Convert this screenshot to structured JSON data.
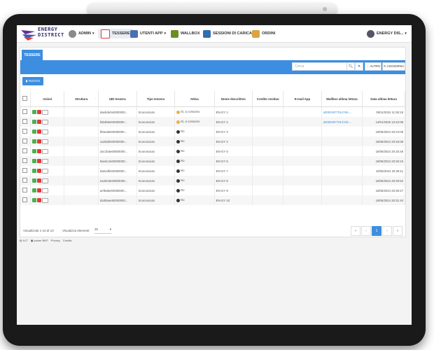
{
  "header": {
    "logo_line1": "ENERGY",
    "logo_line2": "DISTRICT",
    "nav": [
      {
        "label": "ADMIN",
        "icon": "gear-icon"
      },
      {
        "label": "TESSERE",
        "icon": "card-icon"
      },
      {
        "label": "UTENTI APP",
        "icon": "user-icon"
      },
      {
        "label": "WALLBOX",
        "icon": "charger-icon"
      },
      {
        "label": "SESSIONI DI CARICA",
        "icon": "session-icon"
      },
      {
        "label": "ORDINI",
        "icon": "orders-icon"
      }
    ],
    "user_label": "ENERGY DIS..."
  },
  "tab_label": "TESSERE",
  "toolbar": {
    "search_placeholder": "Cerca",
    "altro_label": "ALTRO",
    "aggiorna_label": "AGGIORNA",
    "nuovo_label": "NUOVO"
  },
  "table": {
    "columns": [
      "Azioni",
      "Struttura",
      "UID tessera",
      "Tipo tessera",
      "Attiva",
      "Nome descrittivo",
      "Credito residuo",
      "E-mail App",
      "Wallbox ultima lettura",
      "Data ultima lettura"
    ],
    "rows": [
      {
        "uid": "daebde0e0000000...",
        "tipo": "Sconosciuto",
        "attiva": "Sì, a consumo",
        "attiva_color": "#f0ad4e",
        "nome": "EN-GY 1",
        "wallbox": "a000049779147eb-...",
        "data": "08/11/2024 11:55:18"
      },
      {
        "uid": "fab3b9e60000000...",
        "tipo": "Sconosciuto",
        "attiva": "Sì, a consumo",
        "attiva_color": "#f0ad4e",
        "nome": "EN-GY 2",
        "wallbox": "a000049779147eb-...",
        "data": "14/01/2025 13:42:08"
      },
      {
        "uid": "fb0ea8e60000000...",
        "tipo": "Sconosciuto",
        "attiva": "No",
        "attiva_color": "#333333",
        "nome": "EN-GY 3",
        "wallbox": "",
        "data": "18/06/2024 20:24:09"
      },
      {
        "uid": "1a2dafe60000000...",
        "tipo": "Sconosciuto",
        "attiva": "No",
        "attiva_color": "#333333",
        "nome": "EN-GY 4",
        "wallbox": "",
        "data": "18/06/2024 20:25:09"
      },
      {
        "uid": "2ac1bae60000000...",
        "tipo": "Sconosciuto",
        "attiva": "No",
        "attiva_color": "#333333",
        "nome": "EN-GY 5",
        "wallbox": "",
        "data": "18/06/2024 20:25:48"
      },
      {
        "uid": "9aedc4e60000000...",
        "tipo": "Sconosciuto",
        "attiva": "No",
        "attiva_color": "#333333",
        "nome": "EN-GY 6",
        "wallbox": "",
        "data": "18/06/2024 20:26:19"
      },
      {
        "uid": "5a61dfe60000000...",
        "tipo": "Sconosciuto",
        "attiva": "No",
        "attiva_color": "#333333",
        "nome": "EN-GY 7",
        "wallbox": "",
        "data": "18/06/2024 20:28:11"
      },
      {
        "uid": "ea4dc8e60000000...",
        "tipo": "Sconosciuto",
        "attiva": "No",
        "attiva_color": "#333333",
        "nome": "EN-GY 8",
        "wallbox": "",
        "data": "18/06/2024 20:29:52"
      },
      {
        "uid": "aef5abe60000000...",
        "tipo": "Sconosciuto",
        "attiva": "No",
        "attiva_color": "#333333",
        "nome": "EN-GY 9",
        "wallbox": "",
        "data": "18/06/2024 20:30:27"
      },
      {
        "uid": "da38aae60000000...",
        "tipo": "Sconosciuto",
        "attiva": "No",
        "attiva_color": "#333333",
        "nome": "EN-GY 10",
        "wallbox": "",
        "data": "18/06/2024 20:31:40"
      }
    ]
  },
  "footer": {
    "range_text": "Visualizzati 1-10 di 10",
    "per_page_label": "Visualizza elementi",
    "per_page_value": "25",
    "pages": [
      "«",
      "‹",
      "1",
      "›",
      "»"
    ],
    "current_page": "1"
  },
  "bottom": {
    "lang": "It-IT",
    "power": "power BKP",
    "privacy": "Privacy",
    "credits": "Credits"
  }
}
